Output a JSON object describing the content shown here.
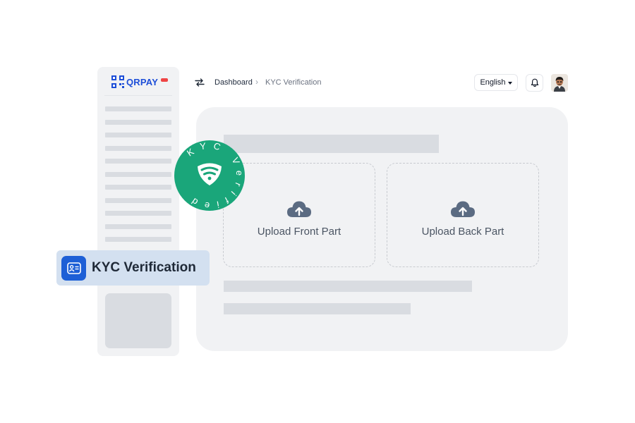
{
  "sidebar": {
    "logo_text": "QRPAY",
    "line_count": 11
  },
  "header": {
    "breadcrumb": [
      "Dashboard",
      "KYC Verification"
    ],
    "breadcrumb_separator": "›",
    "language": "English",
    "icons": [
      "swap-arrows-icon",
      "bell-icon",
      "user-avatar"
    ]
  },
  "main": {
    "upload_front_label": "Upload Front Part",
    "upload_back_label": "Upload Back Part"
  },
  "badge": {
    "label": "KYC Verification"
  },
  "seal": {
    "text": "KYC Verified",
    "color": "#1aa67a"
  },
  "colors": {
    "accent": "#1d5fd6",
    "seal_green": "#1aa67a",
    "chip_bg": "#d3e0f0"
  }
}
